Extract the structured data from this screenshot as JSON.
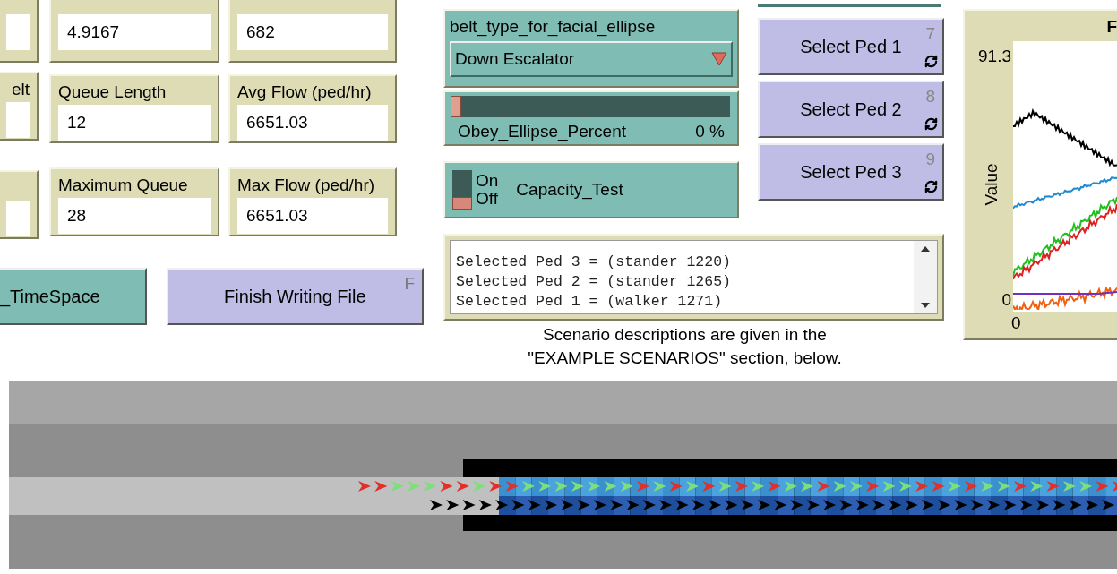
{
  "edge_monitor_label": "elt",
  "monitors": [
    {
      "value": "4.9167"
    },
    {
      "value": "682"
    },
    {
      "label": "Queue Length",
      "value": "12"
    },
    {
      "label": "Avg Flow (ped/hr)",
      "value": "6651.03"
    },
    {
      "label": "Maximum Queue",
      "value": "28"
    },
    {
      "label": "Max Flow (ped/hr)",
      "value": "6651.03"
    }
  ],
  "action_buttons": [
    {
      "kind": "teal",
      "label": "_TimeSpace"
    },
    {
      "kind": "lilac",
      "label": "Finish Writing File",
      "key": "F"
    }
  ],
  "chooser": {
    "label": "belt_type_for_facial_ellipse",
    "value": "Down Escalator"
  },
  "slider": {
    "label": "Obey_Ellipse_Percent",
    "reading": "0 %",
    "level": 0
  },
  "switch": {
    "label": "Capacity_Test",
    "on_text": "On",
    "off_text": "Off",
    "on": false
  },
  "output": {
    "lines": [
      "Selected Ped 3 = (stander 1220)",
      "Selected Ped 2 = (stander 1265)",
      "Selected Ped 1 = (walker 1271)"
    ]
  },
  "note": {
    "lines": [
      "Scenario descriptions are given in the",
      "\"EXAMPLE SCENARIOS\" section, below."
    ]
  },
  "ped_buttons": [
    {
      "label": "Select Ped 1",
      "key": "7",
      "forever": true
    },
    {
      "label": "Select Ped 2",
      "key": "8",
      "forever": true
    },
    {
      "label": "Select Ped 3",
      "key": "9",
      "forever": true
    }
  ],
  "plot": {
    "title": "F",
    "y_max": "91.3",
    "y_min": "0",
    "x_min": "0",
    "ylabel": "Value"
  }
}
